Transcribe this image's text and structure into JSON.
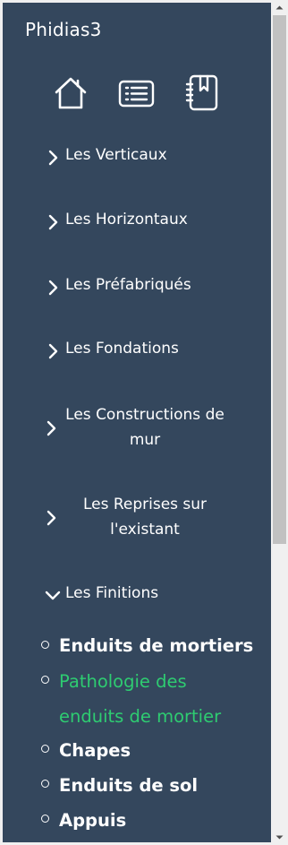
{
  "app": {
    "title": "Phidias3"
  },
  "toolbar": {
    "icons": [
      "home-icon",
      "list-icon",
      "notebook-icon"
    ]
  },
  "menu": {
    "items": [
      {
        "label": "Les Verticaux",
        "expanded": false
      },
      {
        "label": "Les Horizontaux",
        "expanded": false
      },
      {
        "label": "Les Préfabriqués",
        "expanded": false
      },
      {
        "label": "Les Fondations",
        "expanded": false
      },
      {
        "label": "Les Constructions de mur",
        "expanded": false
      },
      {
        "label": "Les Reprises sur l'existant",
        "expanded": false
      },
      {
        "label": "Les Finitions",
        "expanded": true
      }
    ],
    "finitions_subitems": [
      {
        "label": "Enduits de mortiers",
        "active": false
      },
      {
        "label": "Pathologie des enduits de mortier",
        "active": true
      },
      {
        "label": "Chapes",
        "active": false
      },
      {
        "label": "Enduits de sol",
        "active": false
      },
      {
        "label": "Appuis",
        "active": false
      }
    ]
  },
  "colors": {
    "sidebar_bg": "#34475d",
    "text": "#ffffff",
    "active": "#2ecc71",
    "scrollbar_track": "#f0f0f0",
    "scrollbar_thumb": "#c1c1c1"
  }
}
